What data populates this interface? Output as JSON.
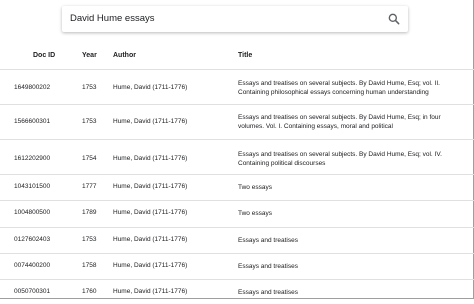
{
  "search": {
    "value": "David Hume essays"
  },
  "table": {
    "headers": {
      "doc_id": "Doc ID",
      "year": "Year",
      "author": "Author",
      "title": "Title"
    },
    "rows": [
      {
        "doc_id": "1649800202",
        "year": "1753",
        "author": "Hume, David (1711-1776)",
        "title": "Essays and treatises on several subjects. By David Hume, Esq; vol. II. Containing philosophical essays concerning human understanding"
      },
      {
        "doc_id": "1566600301",
        "year": "1753",
        "author": "Hume, David (1711-1776)",
        "title": "Essays and treatises on several subjects. By David Hume, Esq; in four volumes. Vol. I. Containing essays, moral and political"
      },
      {
        "doc_id": "1612202900",
        "year": "1754",
        "author": "Hume, David (1711-1776)",
        "title": "Essays and treatises on several subjects. By David Hume, Esq; vol. IV. Containing political discourses"
      },
      {
        "doc_id": "1043101500",
        "year": "1777",
        "author": "Hume, David (1711-1776)",
        "title": "Two essays"
      },
      {
        "doc_id": "1004800500",
        "year": "1789",
        "author": "Hume, David (1711-1776)",
        "title": "Two essays"
      },
      {
        "doc_id": "0127602403",
        "year": "1753",
        "author": "Hume, David (1711-1776)",
        "title": "Essays and treatises"
      },
      {
        "doc_id": "0074400200",
        "year": "1758",
        "author": "Hume, David (1711-1776)",
        "title": "Essays and treatises"
      },
      {
        "doc_id": "0050700301",
        "year": "1760",
        "author": "Hume, David (1711-1776)",
        "title": "Essays and treatises"
      }
    ]
  }
}
